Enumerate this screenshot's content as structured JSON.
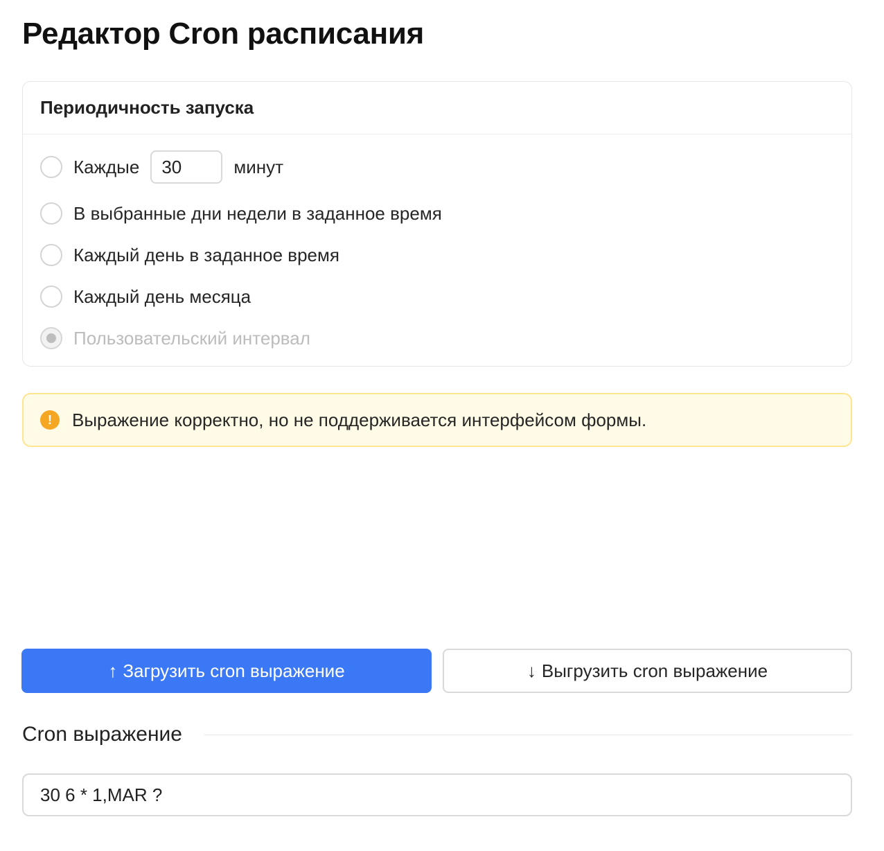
{
  "page": {
    "title": "Редактор Cron расписания"
  },
  "schedule": {
    "header": "Периодичность запуска",
    "every_prefix": "Каждые",
    "every_value": "30",
    "every_suffix": "минут",
    "options": [
      {
        "label": "В выбранные дни недели в заданное время"
      },
      {
        "label": "Каждый день в заданное время"
      },
      {
        "label": "Каждый день месяца"
      },
      {
        "label": "Пользовательский интервал",
        "selected": true,
        "disabled": true
      }
    ]
  },
  "alert": {
    "icon": "exclamation-icon",
    "icon_glyph": "!",
    "text": "Выражение корректно, но не поддерживается интерфейсом формы.",
    "color": "#fffbe6",
    "border": "#ffe58f"
  },
  "actions": {
    "upload_label": "Загрузить cron выражение",
    "upload_icon": "↑",
    "download_label": "Выгрузить cron выражение",
    "download_icon": "↓",
    "primary_color": "#3b78f5"
  },
  "cron": {
    "section_title": "Cron выражение",
    "value": "30 6 * 1,MAR ?"
  }
}
